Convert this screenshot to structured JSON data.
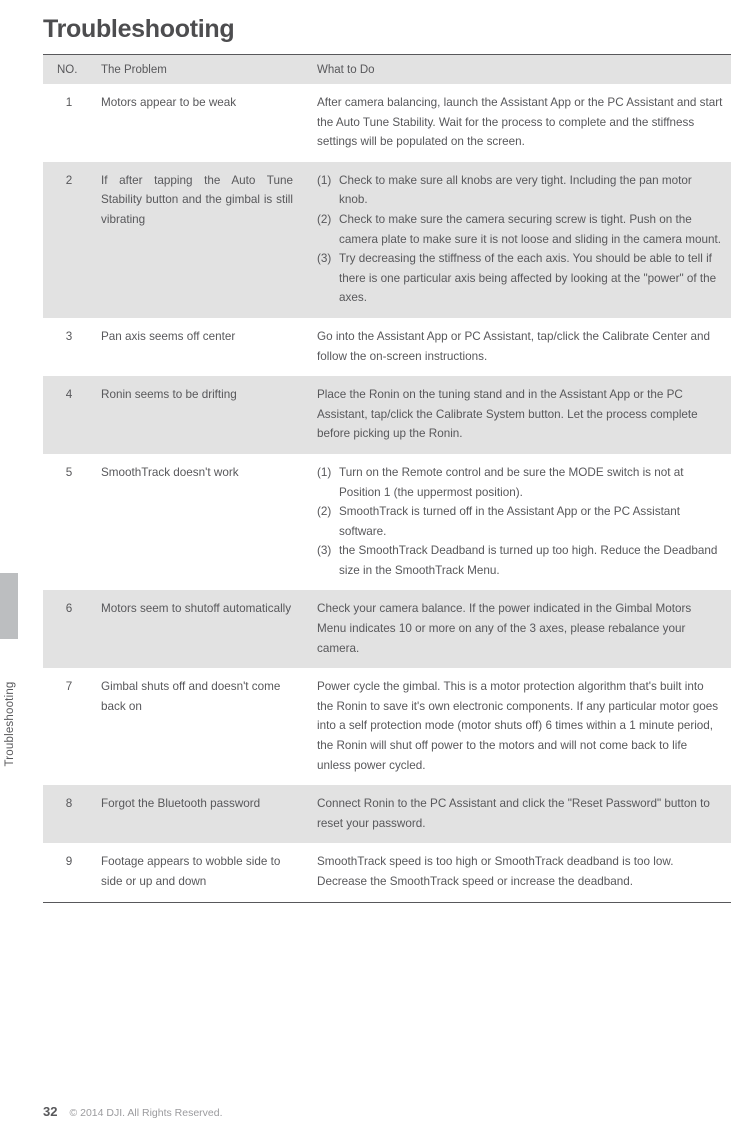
{
  "page": {
    "title": "Troubleshooting",
    "side_tab_label": "Troubleshooting"
  },
  "table": {
    "columns": [
      "NO.",
      "The Problem",
      "What to Do"
    ],
    "rows": [
      {
        "no": "1",
        "problem": "Motors appear to be weak",
        "what_to_do": "After camera balancing, launch the Assistant App or the PC Assistant and start the Auto Tune Stability. Wait for the process to complete and the stiffness settings will be populated on the screen.",
        "steps": [],
        "shaded": false,
        "justified": false
      },
      {
        "no": "2",
        "problem": "If after tapping the Auto Tune Stability button and the gimbal is still vibrating",
        "what_to_do": "",
        "steps": [
          {
            "marker": "(1)",
            "text": "Check to make sure all knobs are very tight. Including the pan motor knob."
          },
          {
            "marker": "(2)",
            "text": "Check to make sure the camera securing screw is tight. Push on the camera plate to make sure it is not loose and sliding in the camera mount."
          },
          {
            "marker": "(3)",
            "text": "Try decreasing the stiffness of the each axis. You should be able to tell if there is one particular axis being affected by looking at the \"power\" of the axes."
          }
        ],
        "shaded": true,
        "justified": true
      },
      {
        "no": "3",
        "problem": "Pan axis seems off center",
        "what_to_do": "Go into the Assistant App or PC Assistant, tap/click the Calibrate Center and follow the on-screen instructions.",
        "steps": [],
        "shaded": false,
        "justified": false
      },
      {
        "no": "4",
        "problem": "Ronin seems to be drifting",
        "what_to_do": "Place the Ronin on the tuning stand and in the Assistant App or the PC Assistant, tap/click the Calibrate System button. Let the process complete before picking up the Ronin.",
        "steps": [],
        "shaded": true,
        "justified": false
      },
      {
        "no": "5",
        "problem": "SmoothTrack doesn't work",
        "what_to_do": "",
        "steps": [
          {
            "marker": "(1)",
            "text": "Turn on the Remote control and be sure the MODE switch is not at Position 1 (the uppermost position)."
          },
          {
            "marker": "(2)",
            "text": "SmoothTrack is turned off in the Assistant App or the PC Assistant software."
          },
          {
            "marker": "(3)",
            "text": "the SmoothTrack Deadband is turned up too high. Reduce the Deadband size in the SmoothTrack Menu."
          }
        ],
        "shaded": false,
        "justified": false
      },
      {
        "no": "6",
        "problem": "Motors seem to shutoff automatically",
        "what_to_do": "Check your camera balance. If the power indicated in the Gimbal Motors Menu indicates 10 or more on any of the 3 axes, please rebalance your camera.",
        "steps": [],
        "shaded": true,
        "justified": false
      },
      {
        "no": "7",
        "problem": "Gimbal shuts off and doesn't come back on",
        "what_to_do": "Power cycle the gimbal. This is a motor protection algorithm that's built into the Ronin to save it's own electronic components. If any particular motor goes into a self protection mode (motor shuts off) 6 times within a 1 minute period, the Ronin will shut off power to the motors and will not come back to life unless power cycled.",
        "steps": [],
        "shaded": false,
        "justified": false
      },
      {
        "no": "8",
        "problem": "Forgot the Bluetooth password",
        "what_to_do": "Connect Ronin to the PC Assistant and click the \"Reset Password\" button to reset your password.",
        "steps": [],
        "shaded": true,
        "justified": false
      },
      {
        "no": "9",
        "problem": "Footage appears to wobble side to side or up and down",
        "what_to_do": "SmoothTrack speed is too high or SmoothTrack deadband is too low. Decrease the SmoothTrack speed or increase the deadband.",
        "steps": [],
        "shaded": false,
        "justified": false
      }
    ]
  },
  "footer": {
    "page_number": "32",
    "copyright": "© 2014 DJI. All Rights Reserved."
  },
  "colors": {
    "text": "#58585b",
    "shaded_row": "#e2e2e2",
    "tab_bar": "#bcbec0",
    "rule": "#58585b",
    "footer_muted": "#9b9b9e"
  }
}
